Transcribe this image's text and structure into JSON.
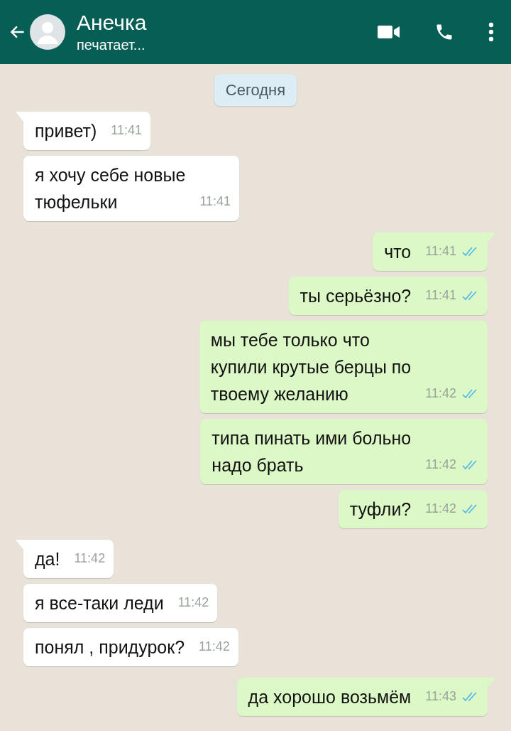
{
  "header": {
    "contact_name": "Анечка",
    "status": "печатает..."
  },
  "date_label": "Сегодня",
  "messages": [
    {
      "outgoing": false,
      "tail": true,
      "text": "привет)",
      "time": "11:41"
    },
    {
      "outgoing": false,
      "tail": false,
      "text": "я хочу себе новые\nтюфельки",
      "time": "11:41"
    },
    {
      "outgoing": true,
      "tail": true,
      "text": "что",
      "time": "11:41",
      "read": true
    },
    {
      "outgoing": true,
      "tail": false,
      "text": "ты серьёзно?",
      "time": "11:41",
      "read": true
    },
    {
      "outgoing": true,
      "tail": false,
      "text": "мы тебе только что\nкупили крутые берцы по\nтвоему желанию",
      "time": "11:42",
      "read": true
    },
    {
      "outgoing": true,
      "tail": false,
      "text": "типа пинать ими больно\nнадо брать",
      "time": "11:42",
      "read": true
    },
    {
      "outgoing": true,
      "tail": false,
      "text": "туфли?",
      "time": "11:42",
      "read": true
    },
    {
      "outgoing": false,
      "tail": true,
      "text": "да!",
      "time": "11:42"
    },
    {
      "outgoing": false,
      "tail": false,
      "text": "я все-таки леди",
      "time": "11:42"
    },
    {
      "outgoing": false,
      "tail": false,
      "text": "понял , придурок?",
      "time": "11:42"
    },
    {
      "outgoing": true,
      "tail": true,
      "text": "да хорошо возьмём",
      "time": "11:43",
      "read": true
    }
  ]
}
